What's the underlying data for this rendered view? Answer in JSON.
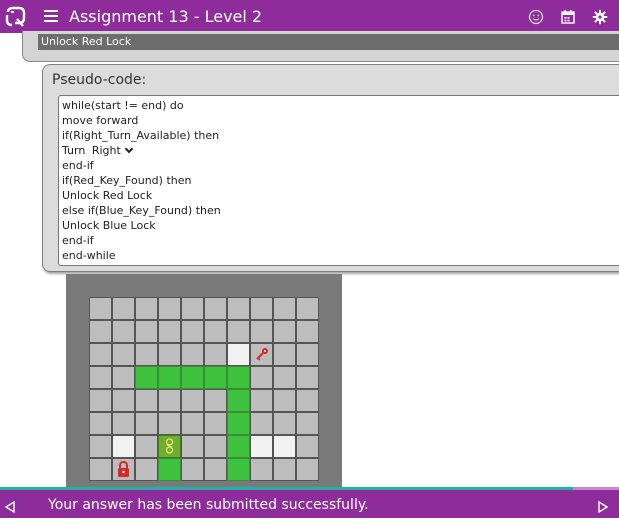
{
  "header": {
    "title": "Assignment 13 - Level 2",
    "icons": [
      "logo-icon",
      "menu-icon",
      "smiley-icon",
      "calendar-icon",
      "settings-icon"
    ]
  },
  "previous_block": {
    "label": "Unlock Red Lock"
  },
  "pseudo_code": {
    "title": "Pseudo-code:",
    "lines": [
      "while(start != end) do",
      "move forward",
      "if(Right_Turn_Available) then",
      "Turn",
      "end-if",
      "if(Red_Key_Found) then",
      "Unlock Red Lock",
      "else if(Blue_Key_Found) then",
      "Unlock Blue Lock",
      "end-if",
      "end-while"
    ],
    "turn_selected": "Right"
  },
  "maze": {
    "rows": 8,
    "cols": 10,
    "white_cells": [
      [
        2,
        6
      ],
      [
        6,
        1
      ],
      [
        6,
        7
      ],
      [
        6,
        8
      ]
    ],
    "green_cells": [
      [
        3,
        2
      ],
      [
        3,
        3
      ],
      [
        3,
        4
      ],
      [
        3,
        5
      ],
      [
        3,
        6
      ],
      [
        4,
        6
      ],
      [
        5,
        6
      ],
      [
        6,
        6
      ],
      [
        7,
        6
      ],
      [
        6,
        3
      ],
      [
        7,
        3
      ]
    ],
    "robot_cell": [
      6,
      3
    ],
    "red_key_cell": [
      2,
      7
    ],
    "red_lock_cell": [
      7,
      1
    ],
    "colors": {
      "wall": "#bdbdbd",
      "open": "#f2f2f2",
      "path": "#3ec23e",
      "key": "#d62a2a"
    }
  },
  "footer": {
    "message": "Your answer has been submitted successfully.",
    "progress_percent": 92.6
  },
  "colors": {
    "brand": "#8e2c9b",
    "progress": "#1fb3a8"
  }
}
